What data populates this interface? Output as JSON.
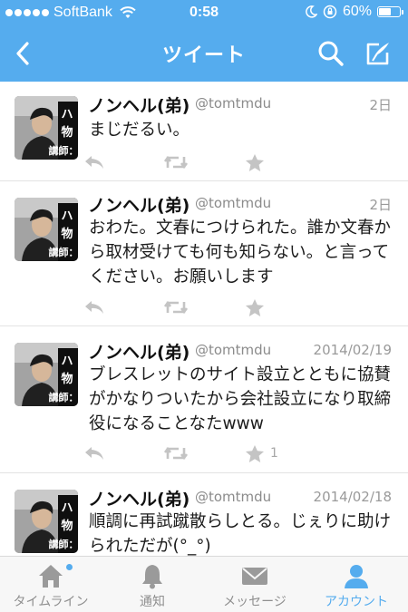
{
  "status_bar": {
    "carrier": "SoftBank",
    "time": "0:58",
    "battery": "60%",
    "battery_level": 0.6
  },
  "nav": {
    "title": "ツイート",
    "back_icon": "chevron-left-icon",
    "search_icon": "search-icon",
    "compose_icon": "compose-icon"
  },
  "tweets": [
    {
      "name": "ノンヘル(弟)",
      "handle": "@tomtmdu",
      "date": "2日",
      "text": "まじだるい。",
      "favorites": ""
    },
    {
      "name": "ノンヘル(弟)",
      "handle": "@tomtmdu",
      "date": "2日",
      "text": "おわた。文春につけられた。誰か文春から取材受けても何も知らない。と言ってください。お願いします",
      "favorites": ""
    },
    {
      "name": "ノンヘル(弟)",
      "handle": "@tomtmdu",
      "date": "2014/02/19",
      "text": "ブレスレットのサイト設立とともに協賛がかなりついたから会社設立になり取締役になることなたwww",
      "favorites": "1"
    },
    {
      "name": "ノンヘル(弟)",
      "handle": "@tomtmdu",
      "date": "2014/02/18",
      "text": "順調に再試蹴散らしとる。じぇりに助けられただが(°_°)",
      "favorites": ""
    }
  ],
  "avatar_caption": {
    "line1": "ハ",
    "line2": "物",
    "line3": "講師："
  },
  "tabbar": {
    "items": [
      {
        "label": "タイムライン",
        "icon": "home-icon",
        "active": false,
        "has_badge": true
      },
      {
        "label": "通知",
        "icon": "bell-icon",
        "active": false,
        "has_badge": false
      },
      {
        "label": "メッセージ",
        "icon": "envelope-icon",
        "active": false,
        "has_badge": false
      },
      {
        "label": "アカウント",
        "icon": "person-icon",
        "active": true,
        "has_badge": false
      }
    ]
  },
  "colors": {
    "brand": "#55acee",
    "inactive": "#8f8f8f",
    "action_icon": "#c4c4c4"
  }
}
